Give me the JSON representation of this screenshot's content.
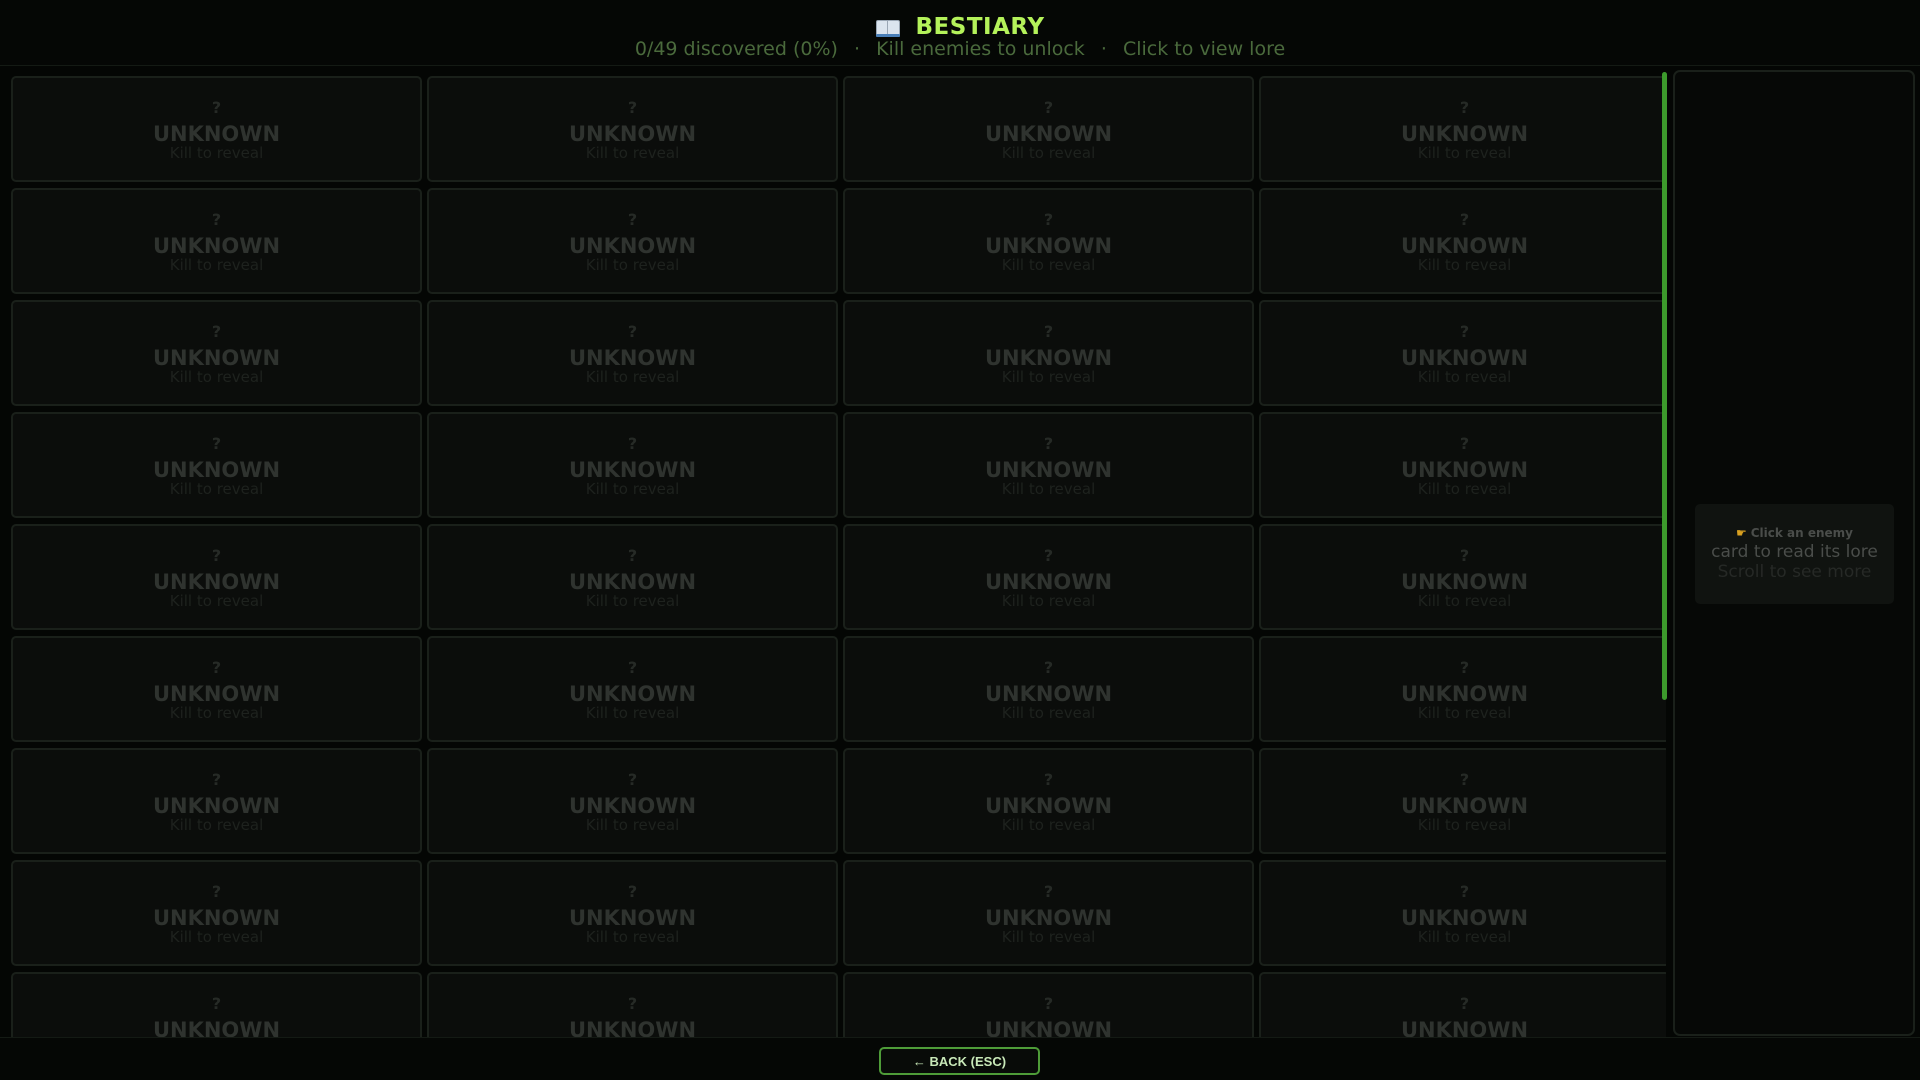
{
  "header": {
    "icon": "open-book-icon",
    "title": "BESTIARY",
    "stats": "0/49 discovered (0%)",
    "unlock_hint": "Kill enemies to unlock",
    "view_hint": "Click to view lore",
    "separator": "·"
  },
  "grid": {
    "columns": 4,
    "card": {
      "glyph": "?",
      "name": "UNKNOWN",
      "hint": "Kill to reveal"
    },
    "visible_count": 36
  },
  "lore_panel": {
    "pointer_icon": "pointing-hand-icon",
    "line1": "Click an enemy",
    "line2": "card to read its lore",
    "line3": "Scroll to see more"
  },
  "footer": {
    "back_label": "← BACK  (ESC)"
  },
  "colors": {
    "accent": "#b4f25a",
    "scroll_thumb": "#3c9a2c",
    "button_border": "#4e9c38"
  }
}
